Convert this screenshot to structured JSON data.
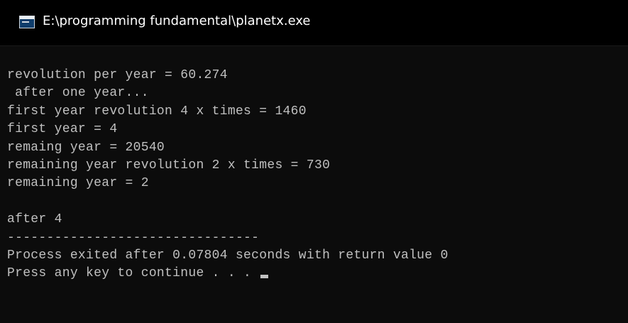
{
  "window": {
    "title": "E:\\programming fundamental\\planetx.exe",
    "icon": "console-app-icon"
  },
  "console": {
    "lines": [
      "revolution per year = 60.274",
      " after one year...",
      "first year revolution 4 x times = 1460",
      "first year = 4",
      "remaing year = 20540",
      "remaining year revolution 2 x times = 730",
      "remaining year = 2",
      "",
      "after 4",
      "--------------------------------",
      "Process exited after 0.07804 seconds with return value 0",
      "Press any key to continue . . . "
    ]
  },
  "colors": {
    "background": "#0c0c0c",
    "titlebar": "#000000",
    "text": "#c0c0c0",
    "title_text": "#ffffff"
  }
}
